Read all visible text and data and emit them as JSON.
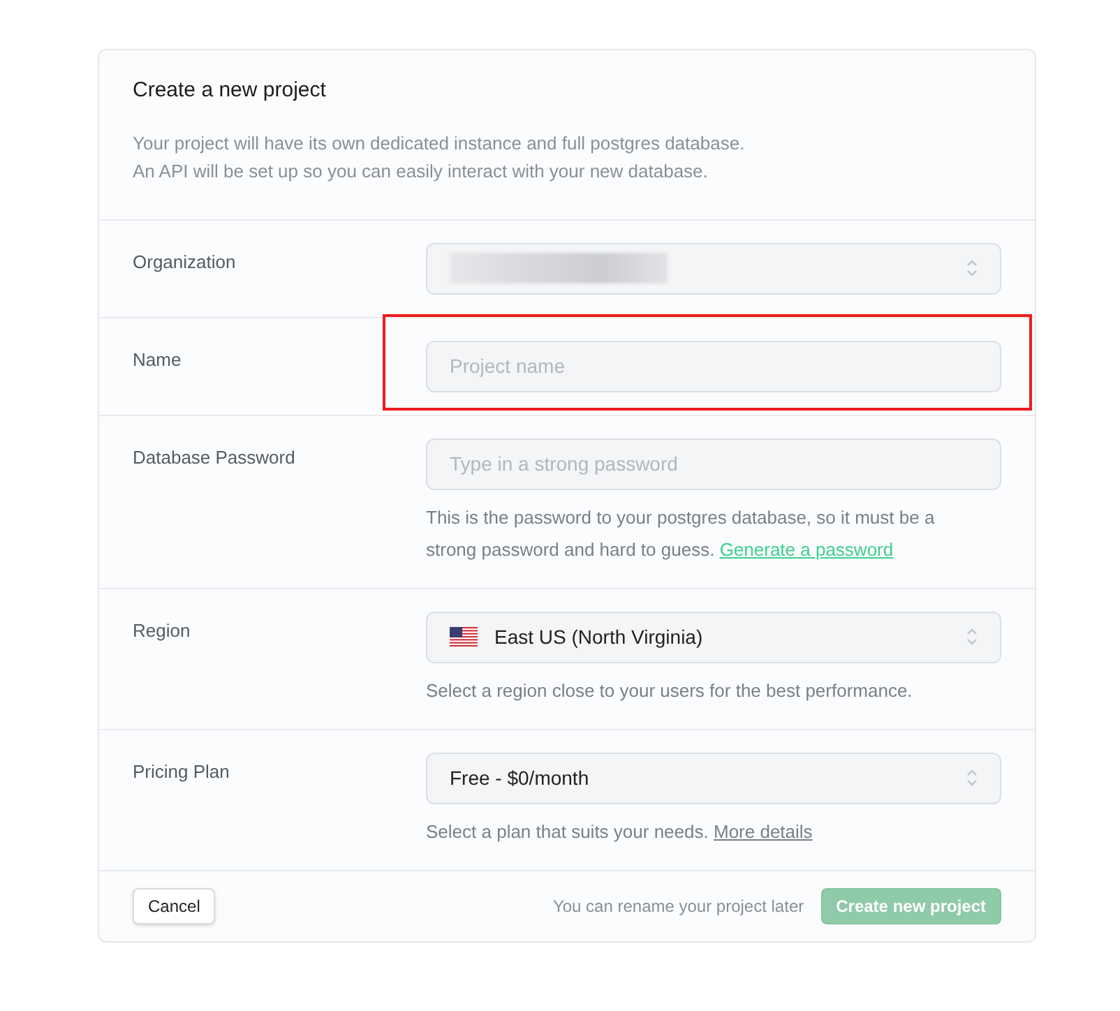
{
  "title": "Create a new project",
  "description": [
    "Your project will have its own dedicated instance and full postgres database.",
    "An API will be set up so you can easily interact with your new database."
  ],
  "rows": [
    {
      "label": "Organization",
      "kind": "select",
      "redacted": true
    },
    {
      "label": "Name",
      "kind": "input",
      "placeholder": "Project name",
      "highlighted": true
    },
    {
      "label": "Database Password",
      "kind": "input",
      "placeholder": "Type in a strong password",
      "help": "This is the password to your postgres database, so it must be a strong password and hard to guess.",
      "link": {
        "text": "Generate a password",
        "kind": "accent"
      }
    },
    {
      "label": "Region",
      "kind": "select",
      "value": "East US (North Virginia)",
      "flag": true,
      "help": "Select a region close to your users for the best performance."
    },
    {
      "label": "Pricing Plan",
      "kind": "select",
      "value": "Free - $0/month",
      "help": "Select a plan that suits your needs.",
      "link": {
        "text": "More details",
        "kind": "muted"
      }
    }
  ],
  "footer": {
    "cancel": "Cancel",
    "note": "You can rename your project later",
    "submit": {
      "label": "Create new project",
      "disabled": true
    }
  }
}
